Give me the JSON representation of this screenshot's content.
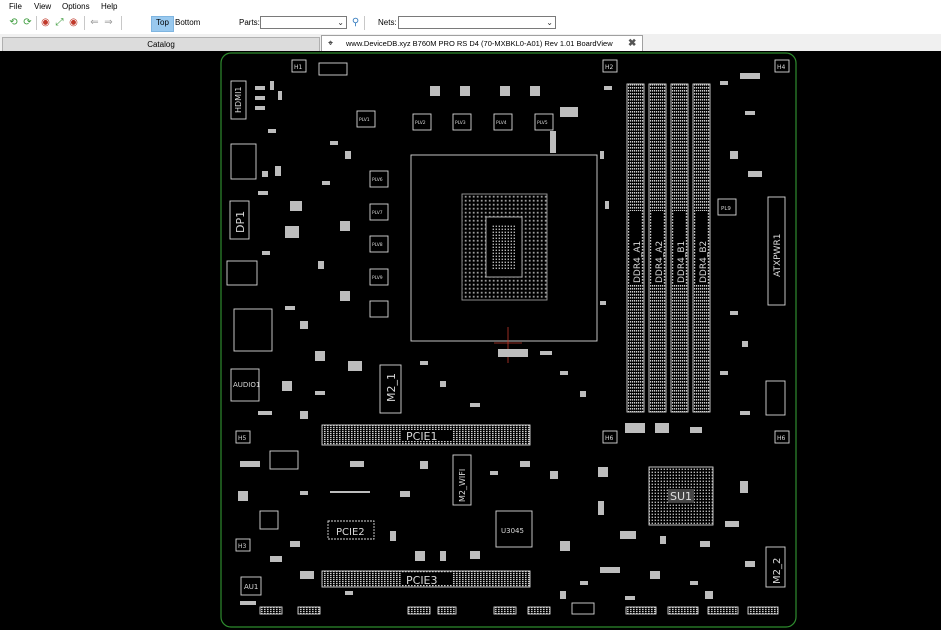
{
  "menu": {
    "file": "File",
    "view": "View",
    "options": "Options",
    "help": "Help"
  },
  "toolbar": {
    "top_label": "Top",
    "bottom_label": "Bottom",
    "active_side": "Top",
    "parts_label": "Parts:",
    "parts_value": "",
    "nets_label": "Nets:",
    "nets_value": ""
  },
  "tabs": {
    "catalog": "Catalog",
    "document": "www.DeviceDB.xyz B760M PRO RS D4 (70-MXBKL0-A01) Rev 1.01 BoardView"
  },
  "colors": {
    "canvas_bg": "#000000",
    "board_outline": "#2e8b2e",
    "component": "#d8d8d8",
    "highlight": "#99c9ef"
  },
  "board": {
    "labels": {
      "hdmi": "HDMI1",
      "dp": "DP1",
      "audio": "AUDIO1",
      "au": "AU1",
      "pcie1": "PCIE1",
      "pcie2": "PCIE2",
      "pcie3": "PCIE3",
      "m2_1": "M2_1",
      "m2_2": "M2_2",
      "m2_wifi": "M2_WIFI",
      "u3045": "U3045",
      "su1": "SU1",
      "atxpwr": "ATXPWR1",
      "ddr_a1": "DDR4_A1",
      "ddr_a2": "DDR4_A2",
      "ddr_b1": "DDR4_B1",
      "ddr_b2": "DDR4_B2",
      "h1": "H1",
      "h2": "H2",
      "h3": "H3",
      "h4": "H4",
      "h5": "H5",
      "h6": "H6",
      "pl9": "PL9",
      "plv1": "PLV1",
      "plv2": "PLV2",
      "plv3": "PLV3",
      "plv4": "PLV4",
      "plv5": "PLV5",
      "plv6": "PLV6",
      "plv7": "PLV7",
      "plv8": "PLV8",
      "plv9": "PLV9"
    }
  }
}
